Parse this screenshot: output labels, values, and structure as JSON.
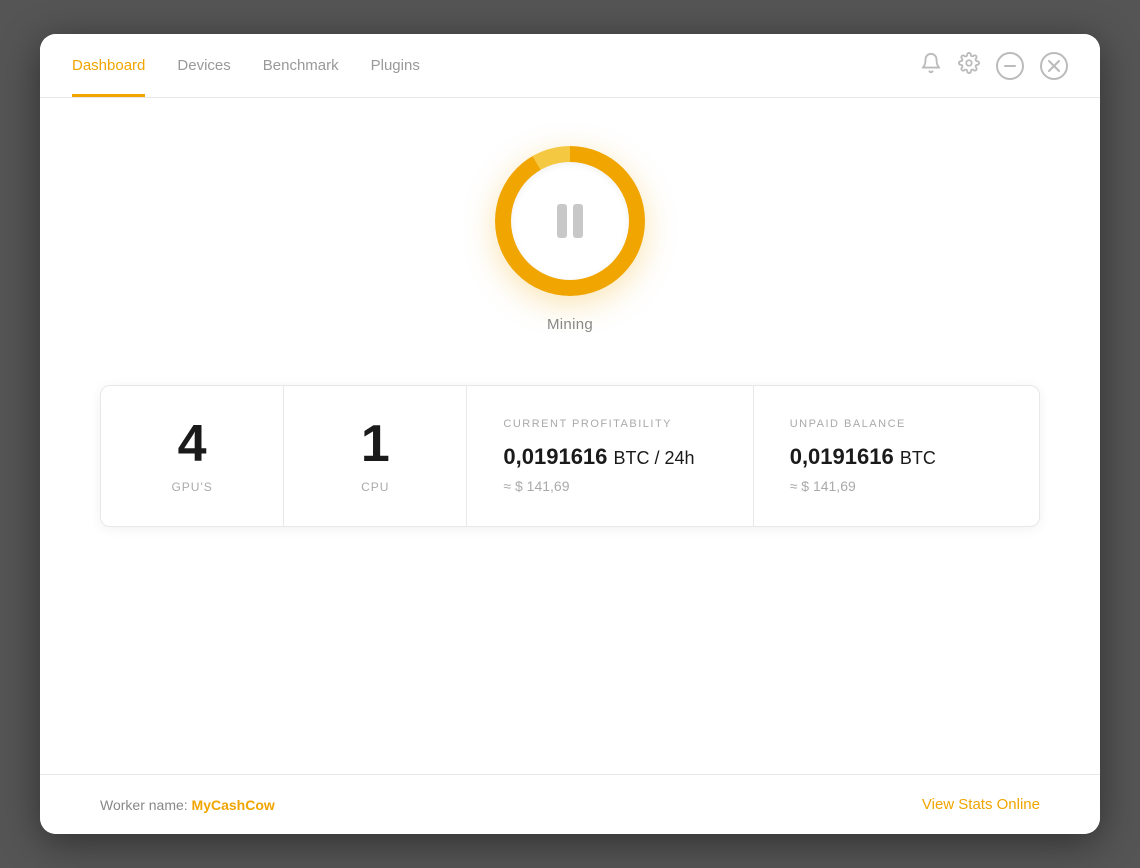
{
  "nav": {
    "tabs": [
      {
        "label": "Dashboard",
        "active": true
      },
      {
        "label": "Devices",
        "active": false
      },
      {
        "label": "Benchmark",
        "active": false
      },
      {
        "label": "Plugins",
        "active": false
      }
    ]
  },
  "mining": {
    "status_label": "Mining"
  },
  "stats": {
    "gpu_count": "4",
    "gpu_label": "GPU'S",
    "cpu_count": "1",
    "cpu_label": "CPU",
    "profitability": {
      "section_label": "CURRENT PROFITABILITY",
      "btc_value": "0,0191616",
      "btc_unit": "BTC / 24h",
      "usd_approx": "≈ $ 141,69"
    },
    "unpaid_balance": {
      "section_label": "UNPAID BALANCE",
      "btc_value": "0,0191616",
      "btc_unit": "BTC",
      "usd_approx": "≈ $ 141,69"
    }
  },
  "footer": {
    "worker_prefix": "Worker name: ",
    "worker_name": "MyCashCow",
    "view_stats_label": "View Stats Online"
  },
  "colors": {
    "accent": "#f0a500",
    "text_muted": "#aaa",
    "text_dark": "#1a1a1a"
  }
}
